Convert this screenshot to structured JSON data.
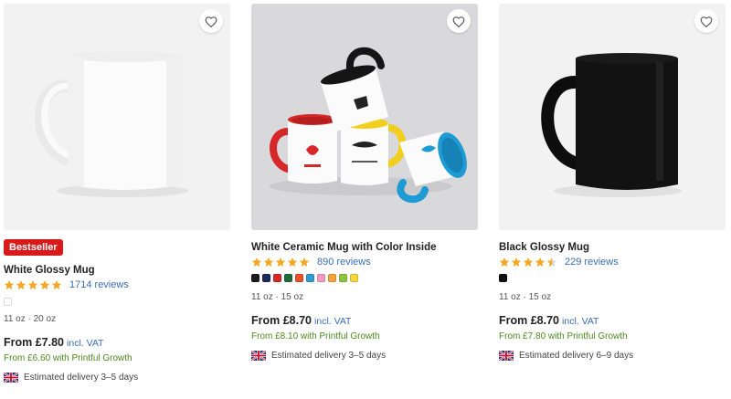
{
  "colors": {
    "bestseller": "#d91a1a",
    "star": "#f5a623",
    "link": "#3a6db5",
    "growth": "#4c8a1e"
  },
  "products": [
    {
      "badge": "Bestseller",
      "title": "White Glossy Mug",
      "rating": 5,
      "reviews": "1714 reviews",
      "sizes": "11 oz · 20 oz",
      "price": "From £7.80",
      "vat": "incl. VAT",
      "growth": "From £6.60 with Printful Growth",
      "delivery": "Estimated delivery 3–5 days"
    },
    {
      "title": "White Ceramic Mug with Color Inside",
      "rating": 5,
      "reviews": "890 reviews",
      "swatches": [
        "#1b1b1b",
        "#1d2a5c",
        "#d62828",
        "#1f6b3a",
        "#e8532b",
        "#2e9bd1",
        "#f49ac1",
        "#f2a33a",
        "#8cc63f",
        "#f6d63a"
      ],
      "sizes": "11 oz · 15 oz",
      "price": "From £8.70",
      "vat": "incl. VAT",
      "growth": "From £8.10 with Printful Growth",
      "delivery": "Estimated delivery 3–5 days"
    },
    {
      "title": "Black Glossy Mug",
      "rating": 4.5,
      "reviews": "229 reviews",
      "swatches": [
        "#111111"
      ],
      "sizes": "11 oz · 15 oz",
      "price": "From £8.70",
      "vat": "incl. VAT",
      "growth": "From £7.80 with Printful Growth",
      "delivery": "Estimated delivery 6–9 days"
    }
  ],
  "icons": {
    "favorite": "heart-icon",
    "rating": "star-icon",
    "flag": "uk-flag-icon"
  }
}
